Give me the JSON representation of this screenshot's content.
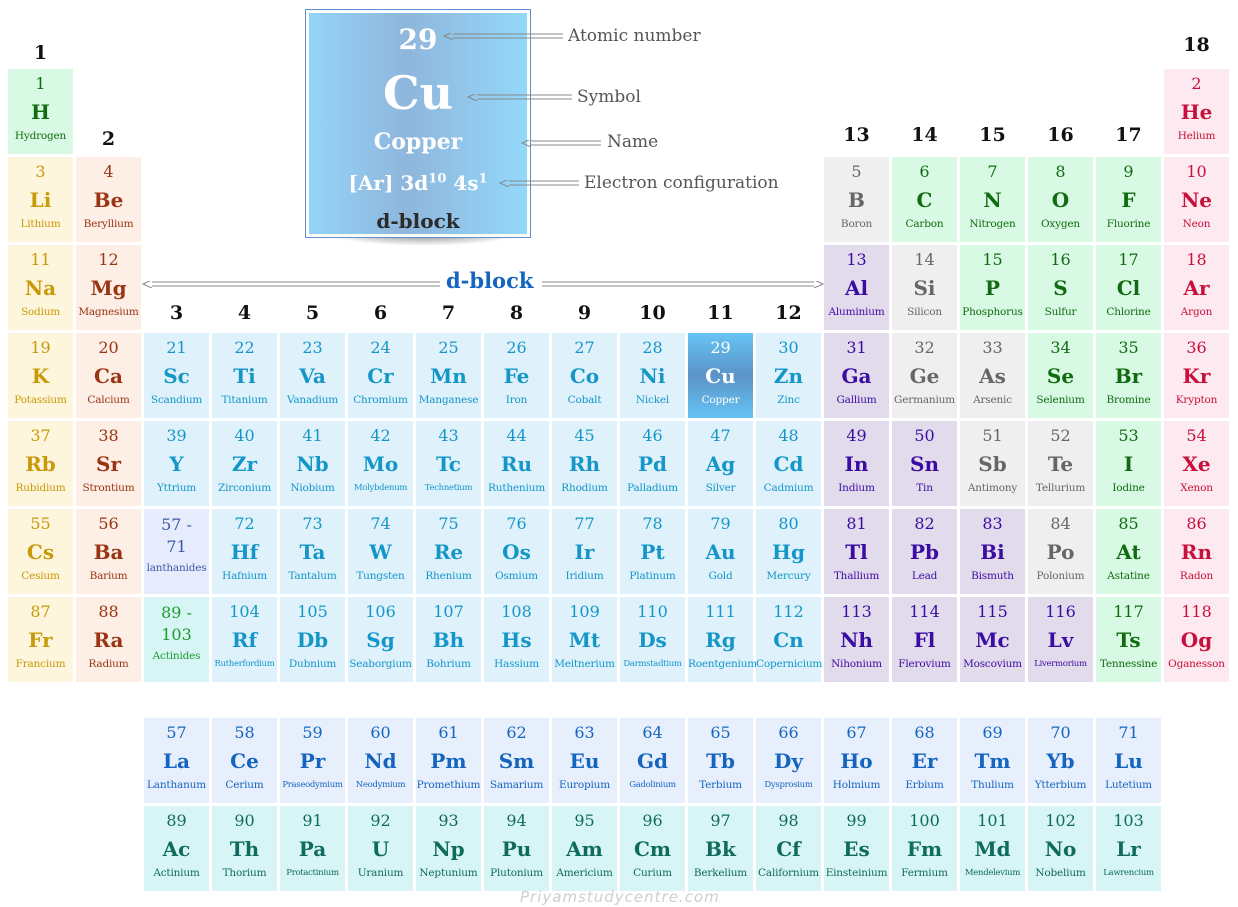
{
  "legend": {
    "atomic_number": "29",
    "symbol": "Cu",
    "name": "Copper",
    "config_prefix": "[Ar] 3d",
    "config_sup1": "10",
    "config_mid": " 4s",
    "config_sup2": "1",
    "block": "d-block",
    "annotations": {
      "atomic_number": "Atomic number",
      "symbol": "Symbol",
      "name": "Name",
      "electron_configuration": "Electron configuration"
    }
  },
  "dblock_label": "d-block",
  "watermark": "Priyamstudycentre.com",
  "groups": [
    "1",
    "2",
    "3",
    "4",
    "5",
    "6",
    "7",
    "8",
    "9",
    "10",
    "11",
    "12",
    "13",
    "14",
    "15",
    "16",
    "17",
    "18"
  ],
  "highlighted_element": "Cu",
  "category_colors": {
    "alkali": "#c9990a",
    "alkaline": "#9a3412",
    "transition": "#1496c8",
    "post_transition": "#3a0ca3",
    "metalloid": "#666666",
    "nonmetal": "#116b11",
    "noble": "#c8103c",
    "lanthanide": "#1565c0",
    "actinide": "#0e6b5e",
    "highlight": "#5b93c8"
  },
  "elements": [
    {
      "n": "1",
      "s": "H",
      "name": "Hydrogen",
      "c": "nonmetal",
      "g": 1,
      "p": 1
    },
    {
      "n": "2",
      "s": "He",
      "name": "Helium",
      "c": "noble",
      "g": 18,
      "p": 1
    },
    {
      "n": "3",
      "s": "Li",
      "name": "Lithium",
      "c": "alkali",
      "g": 1,
      "p": 2
    },
    {
      "n": "4",
      "s": "Be",
      "name": "Beryllium",
      "c": "alkaline",
      "g": 2,
      "p": 2
    },
    {
      "n": "5",
      "s": "B",
      "name": "Boron",
      "c": "metalloid",
      "g": 13,
      "p": 2
    },
    {
      "n": "6",
      "s": "C",
      "name": "Carbon",
      "c": "nonmetal",
      "g": 14,
      "p": 2
    },
    {
      "n": "7",
      "s": "N",
      "name": "Nitrogen",
      "c": "nonmetal",
      "g": 15,
      "p": 2
    },
    {
      "n": "8",
      "s": "O",
      "name": "Oxygen",
      "c": "nonmetal",
      "g": 16,
      "p": 2
    },
    {
      "n": "9",
      "s": "F",
      "name": "Fluorine",
      "c": "nonmetal",
      "g": 17,
      "p": 2
    },
    {
      "n": "10",
      "s": "Ne",
      "name": "Neon",
      "c": "noble",
      "g": 18,
      "p": 2
    },
    {
      "n": "11",
      "s": "Na",
      "name": "Sodium",
      "c": "alkali",
      "g": 1,
      "p": 3
    },
    {
      "n": "12",
      "s": "Mg",
      "name": "Magnesium",
      "c": "alkaline",
      "g": 2,
      "p": 3
    },
    {
      "n": "13",
      "s": "Al",
      "name": "Aluminium",
      "c": "post",
      "g": 13,
      "p": 3
    },
    {
      "n": "14",
      "s": "Si",
      "name": "Silicon",
      "c": "metalloid",
      "g": 14,
      "p": 3
    },
    {
      "n": "15",
      "s": "P",
      "name": "Phosphorus",
      "c": "nonmetal",
      "g": 15,
      "p": 3
    },
    {
      "n": "16",
      "s": "S",
      "name": "Sulfur",
      "c": "nonmetal",
      "g": 16,
      "p": 3
    },
    {
      "n": "17",
      "s": "Cl",
      "name": "Chlorine",
      "c": "nonmetal",
      "g": 17,
      "p": 3
    },
    {
      "n": "18",
      "s": "Ar",
      "name": "Argon",
      "c": "noble",
      "g": 18,
      "p": 3
    },
    {
      "n": "19",
      "s": "K",
      "name": "Potassium",
      "c": "alkali",
      "g": 1,
      "p": 4
    },
    {
      "n": "20",
      "s": "Ca",
      "name": "Calcium",
      "c": "alkaline",
      "g": 2,
      "p": 4
    },
    {
      "n": "21",
      "s": "Sc",
      "name": "Scandium",
      "c": "trans",
      "g": 3,
      "p": 4
    },
    {
      "n": "22",
      "s": "Ti",
      "name": "Titanium",
      "c": "trans",
      "g": 4,
      "p": 4
    },
    {
      "n": "23",
      "s": "Va",
      "name": "Vanadium",
      "c": "trans",
      "g": 5,
      "p": 4
    },
    {
      "n": "24",
      "s": "Cr",
      "name": "Chromium",
      "c": "trans",
      "g": 6,
      "p": 4
    },
    {
      "n": "25",
      "s": "Mn",
      "name": "Manganese",
      "c": "trans",
      "g": 7,
      "p": 4
    },
    {
      "n": "26",
      "s": "Fe",
      "name": "Iron",
      "c": "trans",
      "g": 8,
      "p": 4
    },
    {
      "n": "27",
      "s": "Co",
      "name": "Cobalt",
      "c": "trans",
      "g": 9,
      "p": 4
    },
    {
      "n": "28",
      "s": "Ni",
      "name": "Nickel",
      "c": "trans",
      "g": 10,
      "p": 4
    },
    {
      "n": "29",
      "s": "Cu",
      "name": "Copper",
      "c": "highlight",
      "g": 11,
      "p": 4
    },
    {
      "n": "30",
      "s": "Zn",
      "name": "Zinc",
      "c": "trans",
      "g": 12,
      "p": 4
    },
    {
      "n": "31",
      "s": "Ga",
      "name": "Gallium",
      "c": "post",
      "g": 13,
      "p": 4
    },
    {
      "n": "32",
      "s": "Ge",
      "name": "Germanium",
      "c": "metalloid",
      "g": 14,
      "p": 4
    },
    {
      "n": "33",
      "s": "As",
      "name": "Arsenic",
      "c": "metalloid",
      "g": 15,
      "p": 4
    },
    {
      "n": "34",
      "s": "Se",
      "name": "Selenium",
      "c": "nonmetal",
      "g": 16,
      "p": 4
    },
    {
      "n": "35",
      "s": "Br",
      "name": "Bromine",
      "c": "nonmetal",
      "g": 17,
      "p": 4
    },
    {
      "n": "36",
      "s": "Kr",
      "name": "Krypton",
      "c": "noble",
      "g": 18,
      "p": 4
    },
    {
      "n": "37",
      "s": "Rb",
      "name": "Rubidium",
      "c": "alkali",
      "g": 1,
      "p": 5
    },
    {
      "n": "38",
      "s": "Sr",
      "name": "Strontium",
      "c": "alkaline",
      "g": 2,
      "p": 5
    },
    {
      "n": "39",
      "s": "Y",
      "name": "Yttrium",
      "c": "trans",
      "g": 3,
      "p": 5
    },
    {
      "n": "40",
      "s": "Zr",
      "name": "Zirconium",
      "c": "trans",
      "g": 4,
      "p": 5
    },
    {
      "n": "41",
      "s": "Nb",
      "name": "Niobium",
      "c": "trans",
      "g": 5,
      "p": 5
    },
    {
      "n": "42",
      "s": "Mo",
      "name": "Molybdenum",
      "c": "trans",
      "g": 6,
      "p": 5,
      "small": true
    },
    {
      "n": "43",
      "s": "Tc",
      "name": "Technetium",
      "c": "trans",
      "g": 7,
      "p": 5,
      "small": true
    },
    {
      "n": "44",
      "s": "Ru",
      "name": "Ruthenium",
      "c": "trans",
      "g": 8,
      "p": 5
    },
    {
      "n": "45",
      "s": "Rh",
      "name": "Rhodium",
      "c": "trans",
      "g": 9,
      "p": 5
    },
    {
      "n": "46",
      "s": "Pd",
      "name": "Palladium",
      "c": "trans",
      "g": 10,
      "p": 5
    },
    {
      "n": "47",
      "s": "Ag",
      "name": "Silver",
      "c": "trans",
      "g": 11,
      "p": 5
    },
    {
      "n": "48",
      "s": "Cd",
      "name": "Cadmium",
      "c": "trans",
      "g": 12,
      "p": 5
    },
    {
      "n": "49",
      "s": "In",
      "name": "Indium",
      "c": "post",
      "g": 13,
      "p": 5
    },
    {
      "n": "50",
      "s": "Sn",
      "name": "Tin",
      "c": "post",
      "g": 14,
      "p": 5
    },
    {
      "n": "51",
      "s": "Sb",
      "name": "Antimony",
      "c": "metalloid",
      "g": 15,
      "p": 5
    },
    {
      "n": "52",
      "s": "Te",
      "name": "Tellurium",
      "c": "metalloid",
      "g": 16,
      "p": 5
    },
    {
      "n": "53",
      "s": "I",
      "name": "Iodine",
      "c": "nonmetal",
      "g": 17,
      "p": 5
    },
    {
      "n": "54",
      "s": "Xe",
      "name": "Xenon",
      "c": "noble",
      "g": 18,
      "p": 5
    },
    {
      "n": "55",
      "s": "Cs",
      "name": "Cesium",
      "c": "alkali",
      "g": 1,
      "p": 6
    },
    {
      "n": "56",
      "s": "Ba",
      "name": "Barium",
      "c": "alkaline",
      "g": 2,
      "p": 6
    },
    {
      "n": "57 -\n71",
      "s": "",
      "name": "lanthanides",
      "c": "lanph",
      "g": 3,
      "p": 6,
      "placeholder": true
    },
    {
      "n": "72",
      "s": "Hf",
      "name": "Hafnium",
      "c": "trans",
      "g": 4,
      "p": 6
    },
    {
      "n": "73",
      "s": "Ta",
      "name": "Tantalum",
      "c": "trans",
      "g": 5,
      "p": 6
    },
    {
      "n": "74",
      "s": "W",
      "name": "Tungsten",
      "c": "trans",
      "g": 6,
      "p": 6
    },
    {
      "n": "75",
      "s": "Re",
      "name": "Rhenium",
      "c": "trans",
      "g": 7,
      "p": 6
    },
    {
      "n": "76",
      "s": "Os",
      "name": "Osmium",
      "c": "trans",
      "g": 8,
      "p": 6
    },
    {
      "n": "77",
      "s": "Ir",
      "name": "Iridium",
      "c": "trans",
      "g": 9,
      "p": 6
    },
    {
      "n": "78",
      "s": "Pt",
      "name": "Platinum",
      "c": "trans",
      "g": 10,
      "p": 6
    },
    {
      "n": "79",
      "s": "Au",
      "name": "Gold",
      "c": "trans",
      "g": 11,
      "p": 6
    },
    {
      "n": "80",
      "s": "Hg",
      "name": "Mercury",
      "c": "trans",
      "g": 12,
      "p": 6
    },
    {
      "n": "81",
      "s": "Tl",
      "name": "Thallium",
      "c": "post",
      "g": 13,
      "p": 6
    },
    {
      "n": "82",
      "s": "Pb",
      "name": "Lead",
      "c": "post",
      "g": 14,
      "p": 6
    },
    {
      "n": "83",
      "s": "Bi",
      "name": "Bismuth",
      "c": "post",
      "g": 15,
      "p": 6
    },
    {
      "n": "84",
      "s": "Po",
      "name": "Polonium",
      "c": "metalloid",
      "g": 16,
      "p": 6
    },
    {
      "n": "85",
      "s": "At",
      "name": "Astatine",
      "c": "nonmetal",
      "g": 17,
      "p": 6
    },
    {
      "n": "86",
      "s": "Rn",
      "name": "Radon",
      "c": "noble",
      "g": 18,
      "p": 6
    },
    {
      "n": "87",
      "s": "Fr",
      "name": "Francium",
      "c": "alkali",
      "g": 1,
      "p": 7
    },
    {
      "n": "88",
      "s": "Ra",
      "name": "Radium",
      "c": "alkaline",
      "g": 2,
      "p": 7
    },
    {
      "n": "89 -\n103",
      "s": "",
      "name": "Actinides",
      "c": "actph",
      "g": 3,
      "p": 7,
      "placeholder": true
    },
    {
      "n": "104",
      "s": "Rf",
      "name": "Rutherfordium",
      "c": "trans",
      "g": 4,
      "p": 7,
      "small": true
    },
    {
      "n": "105",
      "s": "Db",
      "name": "Dubnium",
      "c": "trans",
      "g": 5,
      "p": 7
    },
    {
      "n": "106",
      "s": "Sg",
      "name": "Seaborgium",
      "c": "trans",
      "g": 6,
      "p": 7
    },
    {
      "n": "107",
      "s": "Bh",
      "name": "Bohrium",
      "c": "trans",
      "g": 7,
      "p": 7
    },
    {
      "n": "108",
      "s": "Hs",
      "name": "Hassium",
      "c": "trans",
      "g": 8,
      "p": 7
    },
    {
      "n": "109",
      "s": "Mt",
      "name": "Meitnerium",
      "c": "trans",
      "g": 9,
      "p": 7
    },
    {
      "n": "110",
      "s": "Ds",
      "name": "Darmstadtium",
      "c": "trans",
      "g": 10,
      "p": 7,
      "small": true
    },
    {
      "n": "111",
      "s": "Rg",
      "name": "Roentgenium",
      "c": "trans",
      "g": 11,
      "p": 7
    },
    {
      "n": "112",
      "s": "Cn",
      "name": "Copernicium",
      "c": "trans",
      "g": 12,
      "p": 7
    },
    {
      "n": "113",
      "s": "Nh",
      "name": "Nihonium",
      "c": "post",
      "g": 13,
      "p": 7
    },
    {
      "n": "114",
      "s": "Fl",
      "name": "Flerovium",
      "c": "post",
      "g": 14,
      "p": 7
    },
    {
      "n": "115",
      "s": "Mc",
      "name": "Moscovium",
      "c": "post",
      "g": 15,
      "p": 7
    },
    {
      "n": "116",
      "s": "Lv",
      "name": "Livermorium",
      "c": "post",
      "g": 16,
      "p": 7,
      "small": true
    },
    {
      "n": "117",
      "s": "Ts",
      "name": "Tennessine",
      "c": "nonmetal",
      "g": 17,
      "p": 7
    },
    {
      "n": "118",
      "s": "Og",
      "name": "Oganesson",
      "c": "noble",
      "g": 18,
      "p": 7
    },
    {
      "n": "57",
      "s": "La",
      "name": "Lanthanum",
      "c": "lan",
      "g": 3,
      "p": 9
    },
    {
      "n": "58",
      "s": "Ce",
      "name": "Cerium",
      "c": "lan",
      "g": 4,
      "p": 9
    },
    {
      "n": "59",
      "s": "Pr",
      "name": "Praseodymium",
      "c": "lan",
      "g": 5,
      "p": 9,
      "small": true
    },
    {
      "n": "60",
      "s": "Nd",
      "name": "Neodymium",
      "c": "lan",
      "g": 6,
      "p": 9,
      "small": true
    },
    {
      "n": "61",
      "s": "Pm",
      "name": "Promethium",
      "c": "lan",
      "g": 7,
      "p": 9
    },
    {
      "n": "62",
      "s": "Sm",
      "name": "Samarium",
      "c": "lan",
      "g": 8,
      "p": 9
    },
    {
      "n": "63",
      "s": "Eu",
      "name": "Europium",
      "c": "lan",
      "g": 9,
      "p": 9
    },
    {
      "n": "64",
      "s": "Gd",
      "name": "Gadolinium",
      "c": "lan",
      "g": 10,
      "p": 9,
      "small": true
    },
    {
      "n": "65",
      "s": "Tb",
      "name": "Terbium",
      "c": "lan",
      "g": 11,
      "p": 9
    },
    {
      "n": "66",
      "s": "Dy",
      "name": "Dysprosium",
      "c": "lan",
      "g": 12,
      "p": 9,
      "small": true
    },
    {
      "n": "67",
      "s": "Ho",
      "name": "Holmium",
      "c": "lan",
      "g": 13,
      "p": 9
    },
    {
      "n": "68",
      "s": "Er",
      "name": "Erbium",
      "c": "lan",
      "g": 14,
      "p": 9
    },
    {
      "n": "69",
      "s": "Tm",
      "name": "Thulium",
      "c": "lan",
      "g": 15,
      "p": 9
    },
    {
      "n": "70",
      "s": "Yb",
      "name": "Ytterbium",
      "c": "lan",
      "g": 16,
      "p": 9
    },
    {
      "n": "71",
      "s": "Lu",
      "name": "Lutetium",
      "c": "lan",
      "g": 17,
      "p": 9
    },
    {
      "n": "89",
      "s": "Ac",
      "name": "Actinium",
      "c": "act",
      "g": 3,
      "p": 10
    },
    {
      "n": "90",
      "s": "Th",
      "name": "Thorium",
      "c": "act",
      "g": 4,
      "p": 10
    },
    {
      "n": "91",
      "s": "Pa",
      "name": "Protactinium",
      "c": "act",
      "g": 5,
      "p": 10,
      "small": true
    },
    {
      "n": "92",
      "s": "U",
      "name": "Uranium",
      "c": "act",
      "g": 6,
      "p": 10
    },
    {
      "n": "93",
      "s": "Np",
      "name": "Neptunium",
      "c": "act",
      "g": 7,
      "p": 10
    },
    {
      "n": "94",
      "s": "Pu",
      "name": "Plutonium",
      "c": "act",
      "g": 8,
      "p": 10
    },
    {
      "n": "95",
      "s": "Am",
      "name": "Americium",
      "c": "act",
      "g": 9,
      "p": 10
    },
    {
      "n": "96",
      "s": "Cm",
      "name": "Curium",
      "c": "act",
      "g": 10,
      "p": 10
    },
    {
      "n": "97",
      "s": "Bk",
      "name": "Berkelium",
      "c": "act",
      "g": 11,
      "p": 10
    },
    {
      "n": "98",
      "s": "Cf",
      "name": "Californium",
      "c": "act",
      "g": 12,
      "p": 10
    },
    {
      "n": "99",
      "s": "Es",
      "name": "Einsteinium",
      "c": "act",
      "g": 13,
      "p": 10
    },
    {
      "n": "100",
      "s": "Fm",
      "name": "Fermium",
      "c": "act",
      "g": 14,
      "p": 10
    },
    {
      "n": "101",
      "s": "Md",
      "name": "Mendelevium",
      "c": "act",
      "g": 15,
      "p": 10,
      "small": true
    },
    {
      "n": "102",
      "s": "No",
      "name": "Nobelium",
      "c": "act",
      "g": 16,
      "p": 10
    },
    {
      "n": "103",
      "s": "Lr",
      "name": "Lawrencium",
      "c": "act",
      "g": 17,
      "p": 10,
      "small": true
    }
  ]
}
